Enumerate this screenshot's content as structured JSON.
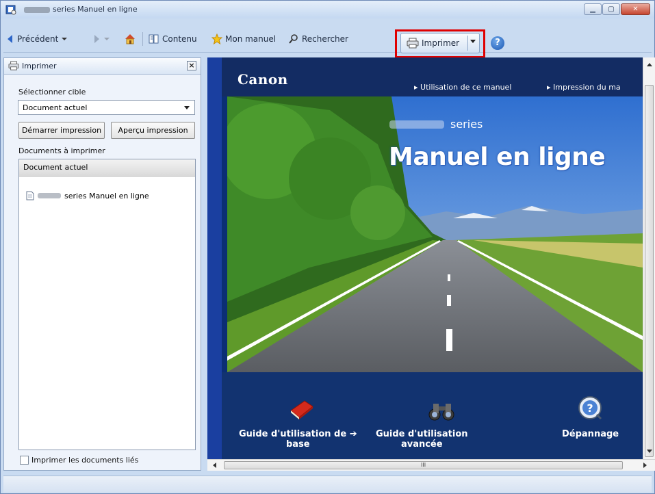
{
  "window": {
    "title_suffix": "series Manuel en ligne"
  },
  "toolbar": {
    "back_label": "Précédent",
    "contents_label": "Contenu",
    "my_manual_label": "Mon manuel",
    "search_label": "Rechercher",
    "print_label": "Imprimer",
    "help_label": "?"
  },
  "print_panel": {
    "title": "Imprimer",
    "select_target_label": "Sélectionner cible",
    "select_target_value": "Document actuel",
    "start_print_button": "Démarrer impression",
    "preview_button": "Aperçu impression",
    "documents_label": "Documents à imprimer",
    "list_header": "Document actuel",
    "list_item_suffix": "series Manuel en ligne",
    "linked_docs_checkbox_label": "Imprimer les documents liés",
    "linked_docs_checked": false
  },
  "content": {
    "brand": "Canon",
    "top_links": [
      "Utilisation de ce manuel",
      "Impression du ma"
    ],
    "series_label": "series",
    "hero_title": "Manuel en ligne",
    "features": [
      {
        "line1": "Guide d'utilisation de",
        "line2": "base",
        "icon": "book-icon"
      },
      {
        "line1": "Guide d'utilisation",
        "line2": "avancée",
        "icon": "binoculars-icon"
      },
      {
        "line1": "Dépannage",
        "line2": "",
        "icon": "troubleshooting-icon"
      }
    ]
  },
  "horizontal_scroll_grip": "III",
  "colors": {
    "highlight": "#e00000",
    "content_bg": "#0b2e74",
    "window_frame": "#c9dbf1"
  }
}
